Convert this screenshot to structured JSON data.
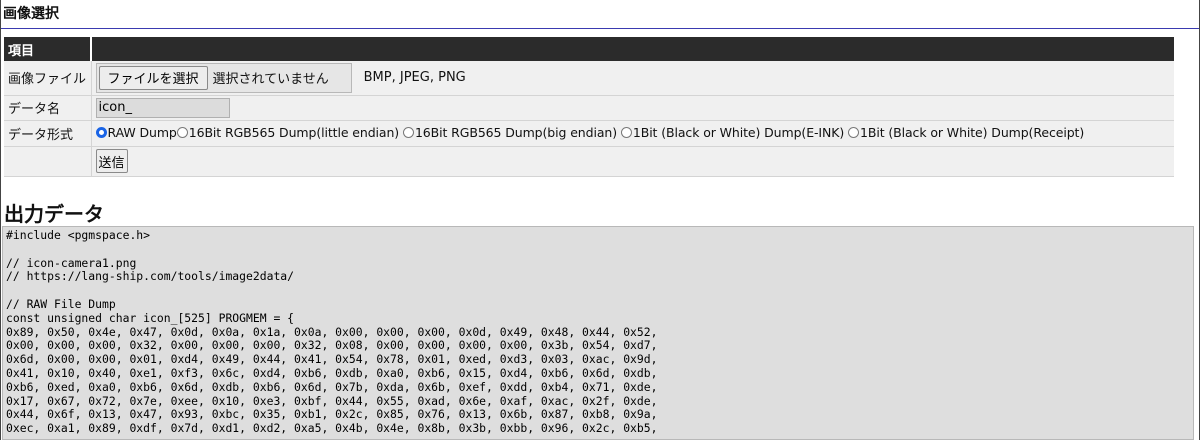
{
  "section_title": "画像選択",
  "table": {
    "header_item": "項目",
    "header_value": ""
  },
  "rows": {
    "file": {
      "label": "画像ファイル",
      "button": "ファイルを選択",
      "status": "選択されていません",
      "formats": "BMP, JPEG, PNG"
    },
    "name": {
      "label": "データ名",
      "value": "icon_"
    },
    "format": {
      "label": "データ形式",
      "selected": "raw",
      "options": [
        {
          "label": "RAW Dump",
          "checked": true
        },
        {
          "label": "16Bit RGB565 Dump(little endian)",
          "checked": false
        },
        {
          "label": "16Bit RGB565 Dump(big endian)",
          "checked": false
        },
        {
          "label": "1Bit (Black or White) Dump(E-INK)",
          "checked": false
        },
        {
          "label": "1Bit (Black or White) Dump(Receipt)",
          "checked": false
        }
      ]
    },
    "submit": {
      "label": "送信"
    }
  },
  "output": {
    "title": "出力データ",
    "text": "#include <pgmspace.h>\n\n// icon-camera1.png\n// https://lang-ship.com/tools/image2data/\n\n// RAW File Dump\nconst unsigned char icon_[525] PROGMEM = {\n0x89, 0x50, 0x4e, 0x47, 0x0d, 0x0a, 0x1a, 0x0a, 0x00, 0x00, 0x00, 0x0d, 0x49, 0x48, 0x44, 0x52,\n0x00, 0x00, 0x00, 0x32, 0x00, 0x00, 0x00, 0x32, 0x08, 0x00, 0x00, 0x00, 0x00, 0x3b, 0x54, 0xd7,\n0x6d, 0x00, 0x00, 0x01, 0xd4, 0x49, 0x44, 0x41, 0x54, 0x78, 0x01, 0xed, 0xd3, 0x03, 0xac, 0x9d,\n0x41, 0x10, 0x40, 0xe1, 0xf3, 0x6c, 0xd4, 0xb6, 0xdb, 0xa0, 0xb6, 0x15, 0xd4, 0xb6, 0x6d, 0xdb,\n0xb6, 0xed, 0xa0, 0xb6, 0x6d, 0xdb, 0xb6, 0x6d, 0x7b, 0xda, 0x6b, 0xef, 0xdd, 0xb4, 0x71, 0xde,\n0x17, 0x67, 0x72, 0x7e, 0xee, 0x10, 0xe3, 0xbf, 0x44, 0x55, 0xad, 0x6e, 0xaf, 0xac, 0x2f, 0xde,\n0x44, 0x6f, 0x13, 0x47, 0x93, 0xbc, 0x35, 0xb1, 0x2c, 0x85, 0x76, 0x13, 0x6b, 0x87, 0xb8, 0x9a,\n0xec, 0xa1, 0x89, 0xdf, 0x7d, 0xd1, 0xd2, 0xa5, 0x4b, 0x4e, 0x8b, 0x3b, 0xbb, 0x96, 0x2c, 0xb5,"
  }
}
